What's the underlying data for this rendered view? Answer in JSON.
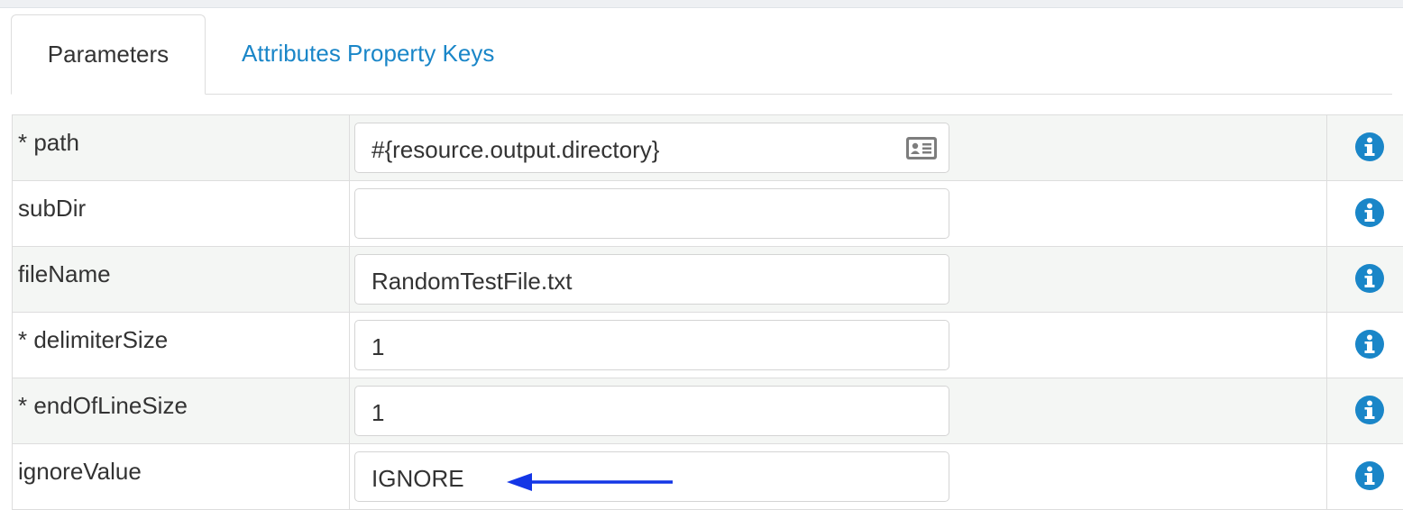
{
  "tabs": {
    "parameters": "Parameters",
    "attributes": "Attributes Property Keys"
  },
  "params": [
    {
      "label": "* path",
      "value": "#{resource.output.directory}",
      "has_picker": true
    },
    {
      "label": "subDir",
      "value": "",
      "has_picker": false
    },
    {
      "label": "fileName",
      "value": "RandomTestFile.txt",
      "has_picker": false
    },
    {
      "label": "* delimiterSize",
      "value": "1",
      "has_picker": false
    },
    {
      "label": "* endOfLineSize",
      "value": "1",
      "has_picker": false
    },
    {
      "label": "ignoreValue",
      "value": "IGNORE",
      "has_picker": false
    }
  ],
  "icons": {
    "info": "info-circle-icon",
    "picker": "id-card-icon",
    "annotation": "blue-arrow-left"
  },
  "colors": {
    "link": "#1a86c8",
    "info": "#1a86c8",
    "arrow": "#1436e6"
  }
}
